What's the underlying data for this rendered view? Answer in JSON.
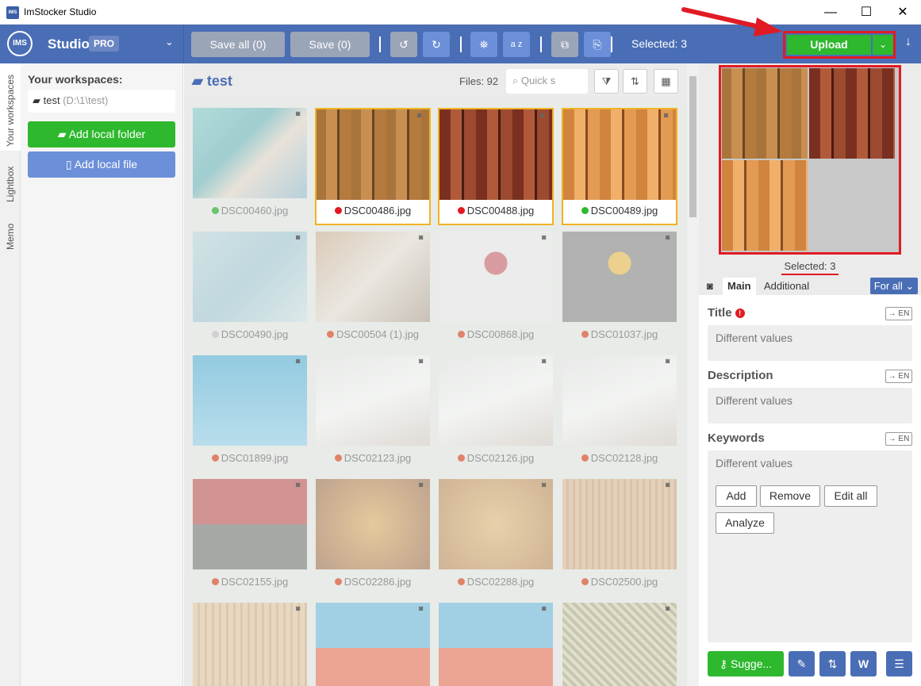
{
  "window": {
    "title": "ImStocker Studio",
    "app_icon": "IMS",
    "minimize": "—",
    "maximize": "☐",
    "close": "✕"
  },
  "toolbar": {
    "logo": "IMS",
    "studio": "Studio",
    "pro": "PRO",
    "chevron": "⌄",
    "save_all": "Save all (0)",
    "save": "Save (0)",
    "undo_icon": "↺",
    "redo_icon": "↻",
    "binoculars_icon": "⛯",
    "sort_az_icon": "a z",
    "copy_icon": "⧉",
    "paste_icon": "⎘",
    "selected": "Selected: 3",
    "upload": "Upload",
    "upload_dd": "⌄",
    "download_icon": "↓"
  },
  "side_tabs": {
    "workspaces": "Your workspaces",
    "lightbox": "Lightbox",
    "memo": "Memo"
  },
  "left_panel": {
    "title": "Your workspaces:",
    "workspace_name": "test",
    "workspace_path": "(D:\\1\\test)",
    "add_folder": "Add local folder",
    "add_file": "Add local file"
  },
  "center": {
    "folder": "test",
    "files": "Files: 92",
    "search_placeholder": "Quick s",
    "filter_icon": "⧩",
    "sort_icon": "⇅",
    "view_icon": "▦"
  },
  "thumbnails": [
    {
      "name": "DSC00460.jpg",
      "dot": "#6cc46c",
      "selected": false,
      "bg": "linear-gradient(135deg,#6cc9c9,#49a8b4 40%,#e8d8c8 60%,#7ab0c9)"
    },
    {
      "name": "DSC00486.jpg",
      "dot": "#e01b24",
      "selected": true,
      "bg": "repeating-linear-gradient(90deg,#a9743c 0 12px,#c88f50 12px 26px,#6b4524 26px 29px,#b47a3e 29px 44px)"
    },
    {
      "name": "DSC00488.jpg",
      "dot": "#e01b24",
      "selected": true,
      "bg": "repeating-linear-gradient(90deg,#7a2f20 0 14px,#b15a3a 14px 28px,#4b1a12 28px 31px,#9c4a30 31px 46px)"
    },
    {
      "name": "DSC00489.jpg",
      "dot": "#2eb82e",
      "selected": true,
      "bg": "repeating-linear-gradient(90deg,#d1843e 0 14px,#f0b06a 14px 28px,#8a4a20 28px 31px,#e39a52 31px 46px)"
    },
    {
      "name": "DSC00490.jpg",
      "dot": "#d0d0d0",
      "selected": false,
      "bg": "linear-gradient(135deg,#b6d8e2,#8fc0d1 50%,#cfe5ec)"
    },
    {
      "name": "DSC00504 (1).jpg",
      "dot": "#e0826a",
      "selected": false,
      "bg": "linear-gradient(135deg,#c9a27f,#ece2d6 50%,#a48e7a)"
    },
    {
      "name": "DSC00868.jpg",
      "dot": "#e0826a",
      "selected": false,
      "bg": "radial-gradient(circle at 50% 35%,#c43a4a 0 14px,#eeeeee 15px)"
    },
    {
      "name": "DSC01037.jpg",
      "dot": "#e0826a",
      "selected": false,
      "bg": "radial-gradient(circle at 50% 35%,#f0b020 0 14px,#6d6d6d 15px)"
    },
    {
      "name": "DSC01899.jpg",
      "dot": "#e0826a",
      "selected": false,
      "bg": "linear-gradient(180deg,#2ba3d6,#7fcdf0)"
    },
    {
      "name": "DSC02123.jpg",
      "dot": "#e0826a",
      "selected": false,
      "bg": "linear-gradient(160deg,#e8e8e8,#ffffff 50%,#d6c8c0)"
    },
    {
      "name": "DSC02126.jpg",
      "dot": "#e0826a",
      "selected": false,
      "bg": "linear-gradient(160deg,#e8e8e8,#ffffff 50%,#d6c8c0)"
    },
    {
      "name": "DSC02128.jpg",
      "dot": "#e0826a",
      "selected": false,
      "bg": "linear-gradient(160deg,#e8e8e8,#ffffff 50%,#d6c8c0)"
    },
    {
      "name": "DSC02155.jpg",
      "dot": "#e0826a",
      "selected": false,
      "bg": "linear-gradient(180deg,#b52a2a 0 50%,#555 50%)"
    },
    {
      "name": "DSC02286.jpg",
      "dot": "#e0826a",
      "selected": false,
      "bg": "radial-gradient(circle,#e0a040,#8a4a20)"
    },
    {
      "name": "DSC02288.jpg",
      "dot": "#e0826a",
      "selected": false,
      "bg": "radial-gradient(circle,#e8b060,#b07030)"
    },
    {
      "name": "DSC02500.jpg",
      "dot": "#e0826a",
      "selected": false,
      "bg": "repeating-linear-gradient(90deg,#e0b080 0 5px,#c89060 5px 8px)"
    },
    {
      "name": "",
      "dot": "",
      "selected": false,
      "bg": "repeating-linear-gradient(90deg,#e8c090 0 6px,#cfa070 6px 9px)"
    },
    {
      "name": "",
      "dot": "",
      "selected": false,
      "bg": "linear-gradient(180deg,#4ab0e0 0 50%,#f05030 50%)"
    },
    {
      "name": "",
      "dot": "",
      "selected": false,
      "bg": "linear-gradient(180deg,#4ab0e0 0 50%,#f05030 50%)"
    },
    {
      "name": "",
      "dot": "",
      "selected": false,
      "bg": "repeating-linear-gradient(45deg,#a09a70 0 4px,#d8d2a8 4px 8px)"
    }
  ],
  "right_panel": {
    "selected": "Selected: 3",
    "tab_main": "Main",
    "tab_additional": "Additional",
    "for_all": "For all ⌄",
    "camera_icon": "◙",
    "title_label": "Title",
    "title_value": "Different values",
    "description_label": "Description",
    "description_value": "Different values",
    "keywords_label": "Keywords",
    "keywords_value": "Different values",
    "en": "→ EN",
    "add": "Add",
    "remove": "Remove",
    "edit_all": "Edit all",
    "analyze": "Analyze",
    "suggest": "Sugge...",
    "pencil_icon": "✎",
    "sort_icon": "⇅",
    "word_icon": "W",
    "menu_icon": "☰"
  },
  "preview": [
    {
      "bg": "repeating-linear-gradient(90deg,#a9743c 0 12px,#c88f50 12px 26px,#6b4524 26px 29px,#b47a3e 29px 44px)"
    },
    {
      "bg": "repeating-linear-gradient(90deg,#7a2f20 0 14px,#b15a3a 14px 28px,#4b1a12 28px 31px,#9c4a30 31px 46px)"
    },
    {
      "bg": "repeating-linear-gradient(90deg,#d1843e 0 14px,#f0b06a 14px 28px,#8a4a20 28px 31px,#e39a52 31px 46px)"
    }
  ]
}
